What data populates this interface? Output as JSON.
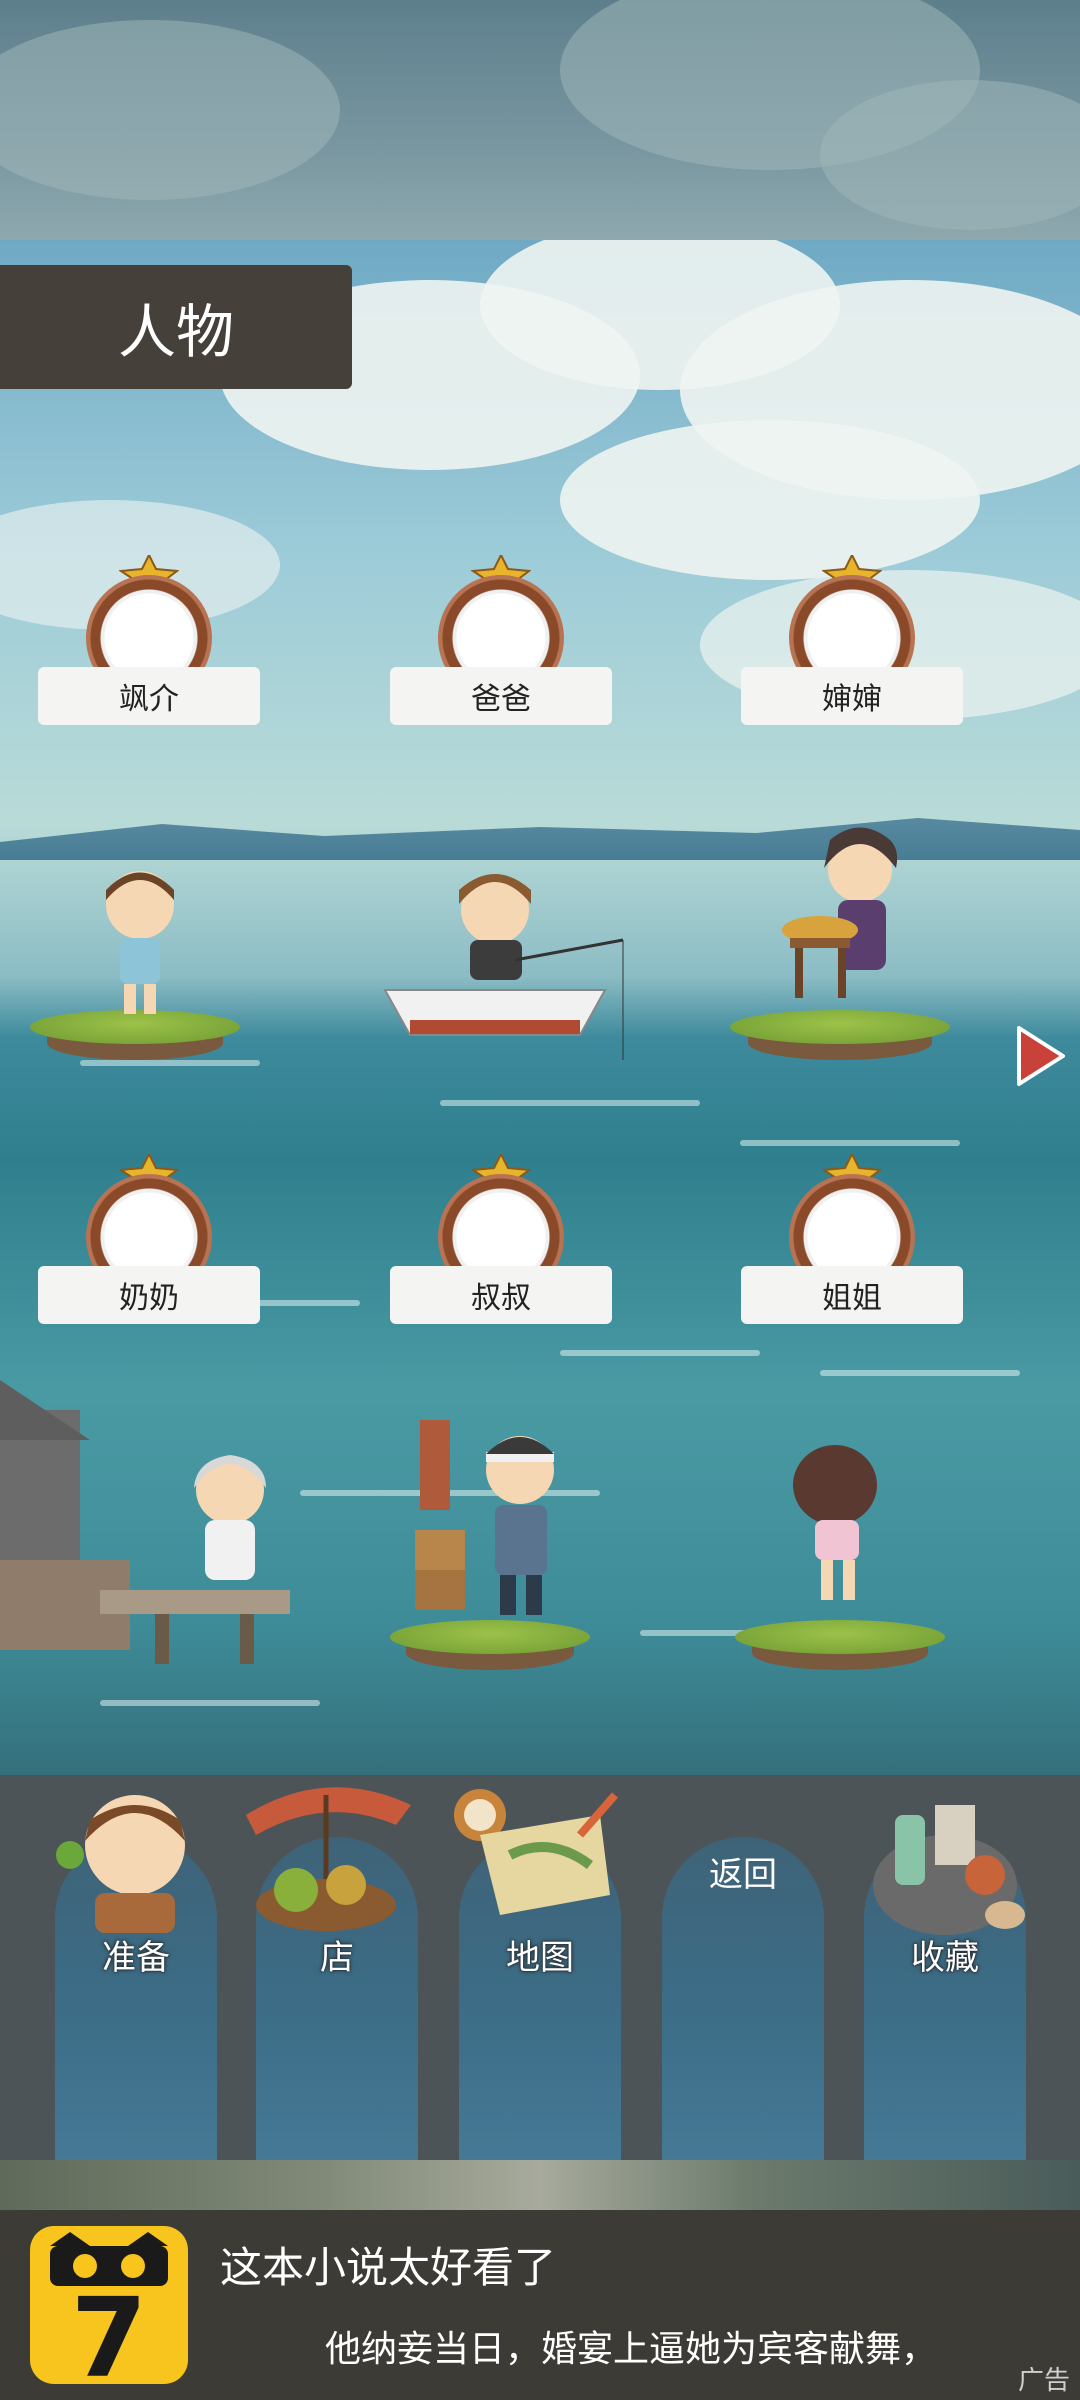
{
  "header": {
    "title": "人物"
  },
  "characters": [
    {
      "name": "飒介"
    },
    {
      "name": "爸爸"
    },
    {
      "name": "婶婶"
    },
    {
      "name": "奶奶"
    },
    {
      "name": "叔叔"
    },
    {
      "name": "姐姐"
    }
  ],
  "navigation": {
    "next_icon": "right-arrow-icon"
  },
  "menu": {
    "items": [
      {
        "label": "准备",
        "icon": "boy-character-icon"
      },
      {
        "label": "店",
        "icon": "market-stall-icon"
      },
      {
        "label": "地图",
        "icon": "map-icon"
      },
      {
        "label": "返回",
        "icon": ""
      },
      {
        "label": "收藏",
        "icon": "collection-bag-icon"
      }
    ]
  },
  "ad": {
    "title": "这本小说太好看了",
    "subtitle": "他纳妾当日，婚宴上逼她为宾客献舞，",
    "tag": "广告",
    "logo_text": "7"
  },
  "colors": {
    "title_bar": "#46403b",
    "menu_bg": "#4c5458",
    "ad_bg": "#3d3b36",
    "logo_yellow": "#f7c51e"
  }
}
